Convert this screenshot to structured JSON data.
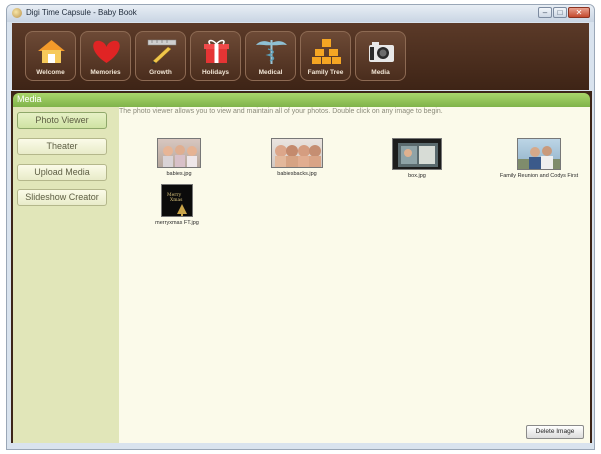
{
  "window": {
    "title": "Digi Time Capsule - Baby Book",
    "minimize_label": "–",
    "maximize_label": "□",
    "close_label": "✕"
  },
  "nav": [
    {
      "label": "Welcome",
      "icon": "house-icon"
    },
    {
      "label": "Memories",
      "icon": "heart-icon"
    },
    {
      "label": "Growth",
      "icon": "ruler-pencil-icon"
    },
    {
      "label": "Holidays",
      "icon": "gift-icon"
    },
    {
      "label": "Medical",
      "icon": "caduceus-icon"
    },
    {
      "label": "Family Tree",
      "icon": "family-tree-icon"
    },
    {
      "label": "Media",
      "icon": "camera-icon"
    }
  ],
  "section": {
    "title": "Media"
  },
  "subtabs": [
    {
      "label": "Photo Viewer",
      "active": true
    },
    {
      "label": "Theater",
      "active": false
    },
    {
      "label": "Upload Media",
      "active": false
    },
    {
      "label": "Slideshow Creator",
      "active": false
    }
  ],
  "viewer": {
    "intro": "The photo viewer allows you to view and maintain all of your photos. Double click on any image to begin.",
    "photos": [
      {
        "caption": "babies.jpg"
      },
      {
        "caption": "babiesbacks.jpg"
      },
      {
        "caption": "box.jpg"
      },
      {
        "caption": "Family Reunion and Codys First"
      },
      {
        "caption": "merryxmas FT.jpg"
      }
    ],
    "delete_label": "Delete Image"
  },
  "colors": {
    "toolbar_brown": "#4a2d1d",
    "accent_green": "#8fc158",
    "sidebar_tan": "#e1e6b9",
    "viewer_cream": "#fbfaea"
  }
}
